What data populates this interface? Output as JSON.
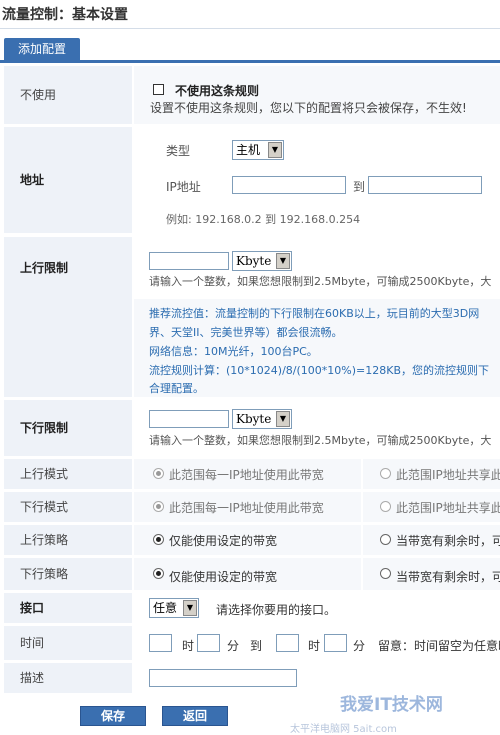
{
  "page_title": "流量控制：基本设置",
  "tab_label": "添加配置",
  "rows": {
    "disable": {
      "label": "不使用",
      "checkbox_label": "不使用这条规则",
      "note": "设置不使用这条规则，您以下的配置将只会被保存，不生效!"
    },
    "address": {
      "label": "地址",
      "type_label": "类型",
      "type_value": "主机",
      "ip_label": "IP地址",
      "to": "到",
      "ip_start": "",
      "ip_end": "",
      "example": "例如:  192.168.0.2  到   192.168.0.254"
    },
    "up_limit": {
      "label": "上行限制",
      "value": "",
      "unit": "Kbyte",
      "hint": "请输入一个整数，如果您想限制到2.5Mbyte，可输成2500Kbyte，大"
    },
    "recommend": {
      "line1": "推荐流控值：流量控制的下行限制在60KB以上，玩目前的大型3D网",
      "line2": "界、天堂II、完美世界等）都会很流畅。",
      "line3": "网络信息：10M光纤，100台PC。",
      "line4": "流控规则计算：(10*1024)/8/(100*10%)=128KB，您的流控规则下",
      "line5": "合理配置。"
    },
    "down_limit": {
      "label": "下行限制",
      "value": "",
      "unit": "Kbyte",
      "hint": "请输入一个整数，如果您想限制到2.5Mbyte，可输成2500Kbyte，大"
    },
    "up_mode": {
      "label": "上行模式",
      "opt1": "此范围每一IP地址使用此带宽",
      "opt2": "此范围IP地址共享此"
    },
    "down_mode": {
      "label": "下行模式",
      "opt1": "此范围每一IP地址使用此带宽",
      "opt2": "此范围IP地址共享此"
    },
    "up_policy": {
      "label": "上行策略",
      "opt1": "仅能使用设定的带宽",
      "opt2": "当带宽有剩余时，可"
    },
    "down_policy": {
      "label": "下行策略",
      "opt1": "仅能使用设定的带宽",
      "opt2": "当带宽有剩余时，可"
    },
    "interface": {
      "label": "接口",
      "value": "任意",
      "hint": "请选择你要用的接口。"
    },
    "time": {
      "label": "时间",
      "hour": "时",
      "minute": "分",
      "to": "到",
      "hint": "留意：时间留空为任意时"
    },
    "desc": {
      "label": "描述",
      "value": ""
    }
  },
  "buttons": {
    "save": "保存",
    "back": "返回"
  },
  "watermark": {
    "line1": "我爱IT技术网",
    "line2": "太平洋电脑网 5ait.com"
  },
  "colors": {
    "accent": "#3a6fb0",
    "label_bg": "#eef2f8",
    "value_bg": "#f6f8fb",
    "link_blue": "#2b6cb0"
  }
}
